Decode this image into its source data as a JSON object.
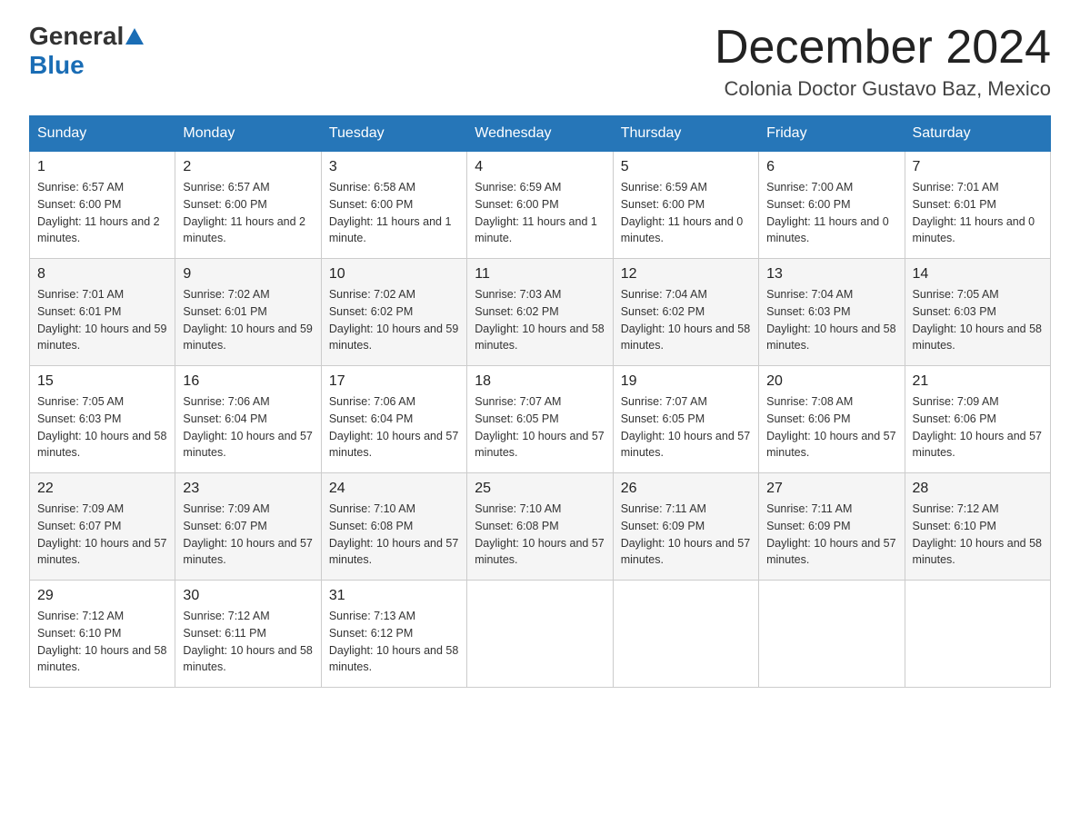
{
  "header": {
    "logo_text_general": "General",
    "logo_text_blue": "Blue",
    "month_title": "December 2024",
    "location": "Colonia Doctor Gustavo Baz, Mexico"
  },
  "weekdays": [
    "Sunday",
    "Monday",
    "Tuesday",
    "Wednesday",
    "Thursday",
    "Friday",
    "Saturday"
  ],
  "weeks": [
    [
      {
        "day": "1",
        "sunrise": "6:57 AM",
        "sunset": "6:00 PM",
        "daylight": "11 hours and 2 minutes."
      },
      {
        "day": "2",
        "sunrise": "6:57 AM",
        "sunset": "6:00 PM",
        "daylight": "11 hours and 2 minutes."
      },
      {
        "day": "3",
        "sunrise": "6:58 AM",
        "sunset": "6:00 PM",
        "daylight": "11 hours and 1 minute."
      },
      {
        "day": "4",
        "sunrise": "6:59 AM",
        "sunset": "6:00 PM",
        "daylight": "11 hours and 1 minute."
      },
      {
        "day": "5",
        "sunrise": "6:59 AM",
        "sunset": "6:00 PM",
        "daylight": "11 hours and 0 minutes."
      },
      {
        "day": "6",
        "sunrise": "7:00 AM",
        "sunset": "6:00 PM",
        "daylight": "11 hours and 0 minutes."
      },
      {
        "day": "7",
        "sunrise": "7:01 AM",
        "sunset": "6:01 PM",
        "daylight": "11 hours and 0 minutes."
      }
    ],
    [
      {
        "day": "8",
        "sunrise": "7:01 AM",
        "sunset": "6:01 PM",
        "daylight": "10 hours and 59 minutes."
      },
      {
        "day": "9",
        "sunrise": "7:02 AM",
        "sunset": "6:01 PM",
        "daylight": "10 hours and 59 minutes."
      },
      {
        "day": "10",
        "sunrise": "7:02 AM",
        "sunset": "6:02 PM",
        "daylight": "10 hours and 59 minutes."
      },
      {
        "day": "11",
        "sunrise": "7:03 AM",
        "sunset": "6:02 PM",
        "daylight": "10 hours and 58 minutes."
      },
      {
        "day": "12",
        "sunrise": "7:04 AM",
        "sunset": "6:02 PM",
        "daylight": "10 hours and 58 minutes."
      },
      {
        "day": "13",
        "sunrise": "7:04 AM",
        "sunset": "6:03 PM",
        "daylight": "10 hours and 58 minutes."
      },
      {
        "day": "14",
        "sunrise": "7:05 AM",
        "sunset": "6:03 PM",
        "daylight": "10 hours and 58 minutes."
      }
    ],
    [
      {
        "day": "15",
        "sunrise": "7:05 AM",
        "sunset": "6:03 PM",
        "daylight": "10 hours and 58 minutes."
      },
      {
        "day": "16",
        "sunrise": "7:06 AM",
        "sunset": "6:04 PM",
        "daylight": "10 hours and 57 minutes."
      },
      {
        "day": "17",
        "sunrise": "7:06 AM",
        "sunset": "6:04 PM",
        "daylight": "10 hours and 57 minutes."
      },
      {
        "day": "18",
        "sunrise": "7:07 AM",
        "sunset": "6:05 PM",
        "daylight": "10 hours and 57 minutes."
      },
      {
        "day": "19",
        "sunrise": "7:07 AM",
        "sunset": "6:05 PM",
        "daylight": "10 hours and 57 minutes."
      },
      {
        "day": "20",
        "sunrise": "7:08 AM",
        "sunset": "6:06 PM",
        "daylight": "10 hours and 57 minutes."
      },
      {
        "day": "21",
        "sunrise": "7:09 AM",
        "sunset": "6:06 PM",
        "daylight": "10 hours and 57 minutes."
      }
    ],
    [
      {
        "day": "22",
        "sunrise": "7:09 AM",
        "sunset": "6:07 PM",
        "daylight": "10 hours and 57 minutes."
      },
      {
        "day": "23",
        "sunrise": "7:09 AM",
        "sunset": "6:07 PM",
        "daylight": "10 hours and 57 minutes."
      },
      {
        "day": "24",
        "sunrise": "7:10 AM",
        "sunset": "6:08 PM",
        "daylight": "10 hours and 57 minutes."
      },
      {
        "day": "25",
        "sunrise": "7:10 AM",
        "sunset": "6:08 PM",
        "daylight": "10 hours and 57 minutes."
      },
      {
        "day": "26",
        "sunrise": "7:11 AM",
        "sunset": "6:09 PM",
        "daylight": "10 hours and 57 minutes."
      },
      {
        "day": "27",
        "sunrise": "7:11 AM",
        "sunset": "6:09 PM",
        "daylight": "10 hours and 57 minutes."
      },
      {
        "day": "28",
        "sunrise": "7:12 AM",
        "sunset": "6:10 PM",
        "daylight": "10 hours and 58 minutes."
      }
    ],
    [
      {
        "day": "29",
        "sunrise": "7:12 AM",
        "sunset": "6:10 PM",
        "daylight": "10 hours and 58 minutes."
      },
      {
        "day": "30",
        "sunrise": "7:12 AM",
        "sunset": "6:11 PM",
        "daylight": "10 hours and 58 minutes."
      },
      {
        "day": "31",
        "sunrise": "7:13 AM",
        "sunset": "6:12 PM",
        "daylight": "10 hours and 58 minutes."
      },
      null,
      null,
      null,
      null
    ]
  ],
  "labels": {
    "sunrise": "Sunrise:",
    "sunset": "Sunset:",
    "daylight": "Daylight:"
  }
}
